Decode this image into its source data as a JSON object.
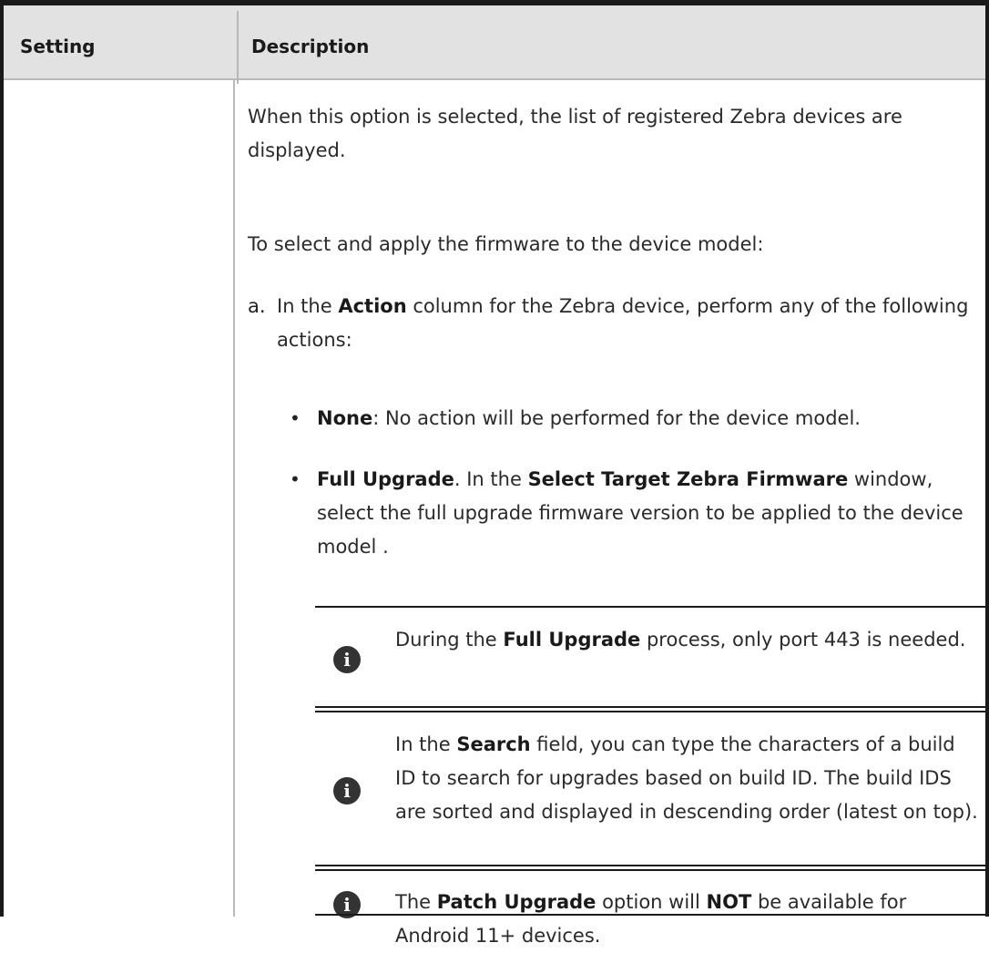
{
  "table": {
    "headers": {
      "setting": "Setting",
      "description": "Description"
    }
  },
  "content": {
    "intro": "When this option is selected, the list of registered Zebra devices are displayed.",
    "instruction": "To select and apply the firmware to the device model:",
    "step_a": {
      "label": "a.",
      "pre": "In the ",
      "bold": "Action",
      "post": " column for the Zebra device, perform any of the following actions:"
    },
    "bullets": [
      {
        "bold": "None",
        "text": ": No action will be performed for the device model."
      },
      {
        "bold": "Full Upgrade",
        "text1": ". In the ",
        "bold2": "Select Target Zebra Firmware",
        "text2": " window, select the full upgrade firmware version to be applied to the device model ."
      }
    ],
    "notes": [
      {
        "pre": "During the ",
        "bold": "Full Upgrade",
        "post": " process, only port 443 is needed."
      },
      {
        "pre": "In the ",
        "bold": "Search",
        "post": " field, you can type the characters of a build ID to search for upgrades based on build ID. The build IDS are sorted and displayed in descending order (latest on top)."
      },
      {
        "pre": "The ",
        "bold": "Patch Upgrade",
        "mid": " option will ",
        "bold2": "NOT",
        "post": " be available for Android 11+ devices."
      }
    ],
    "icons": {
      "note": "info-icon",
      "glyph": "i"
    },
    "colors": {
      "header_bg": "#e2e2e2",
      "border": "#1a1a1a",
      "icon": "#333333"
    }
  }
}
